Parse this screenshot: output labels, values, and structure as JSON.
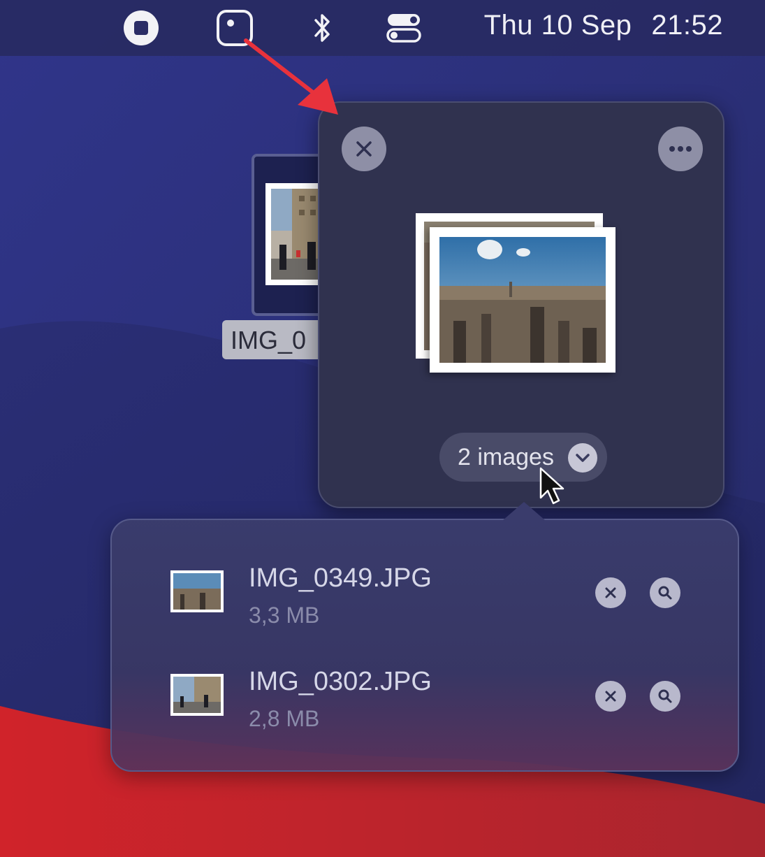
{
  "menubar": {
    "icons": [
      "stop-icon",
      "dropzone-app-icon",
      "bluetooth-icon",
      "control-center-icon"
    ],
    "clock": {
      "date": "Thu 10 Sep",
      "time": "21:52"
    }
  },
  "desktop": {
    "file_label": "IMG_0"
  },
  "popover": {
    "close_icon": "close-icon",
    "more_icon": "more-icon",
    "images_pill_label": "2 images",
    "pill_icon": "chevron-down-icon"
  },
  "file_list": {
    "items": [
      {
        "name": "IMG_0349.JPG",
        "size": "3,3 MB"
      },
      {
        "name": "IMG_0302.JPG",
        "size": "2,8 MB"
      }
    ],
    "remove_icon": "close-icon",
    "preview_icon": "magnifier-icon"
  },
  "colors": {
    "wallpaper_blue": "#2b2f70",
    "wallpaper_red": "#c8222c",
    "popover_bg": "#30324f",
    "annotation_arrow": "#e8323c"
  }
}
